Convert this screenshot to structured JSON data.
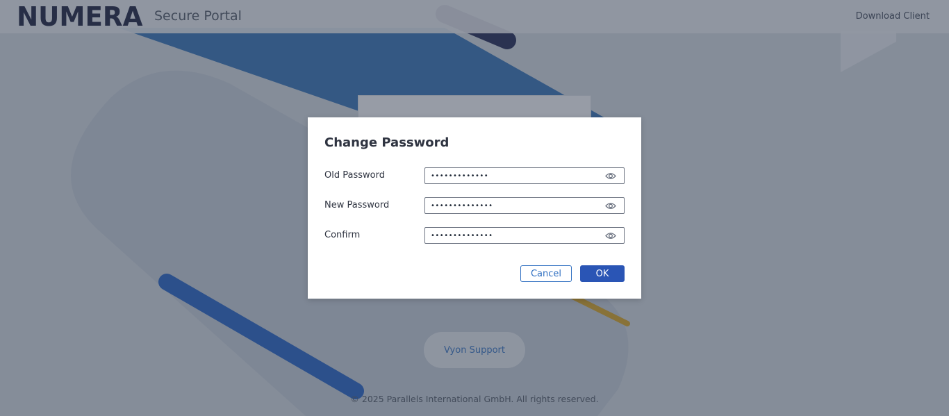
{
  "header": {
    "logo_text": "NUMERA",
    "portal_title": "Secure Portal",
    "download_label": "Download Client"
  },
  "background": {
    "support_label": "Vyon Support",
    "footer_text": "© 2025 Parallels International GmbH. All rights reserved."
  },
  "dialog": {
    "title": "Change Password",
    "fields": [
      {
        "label": "Old Password",
        "value": "•••••••••••••"
      },
      {
        "label": "New Password",
        "value": "••••••••••••••"
      },
      {
        "label": "Confirm",
        "value": "••••••••••••••"
      }
    ],
    "cancel_label": "Cancel",
    "ok_label": "OK"
  },
  "colors": {
    "accent": "#2a55b5",
    "link": "#2f6fc1",
    "logo": "#141a3a"
  },
  "icons": {
    "show_password": "eye-icon"
  }
}
